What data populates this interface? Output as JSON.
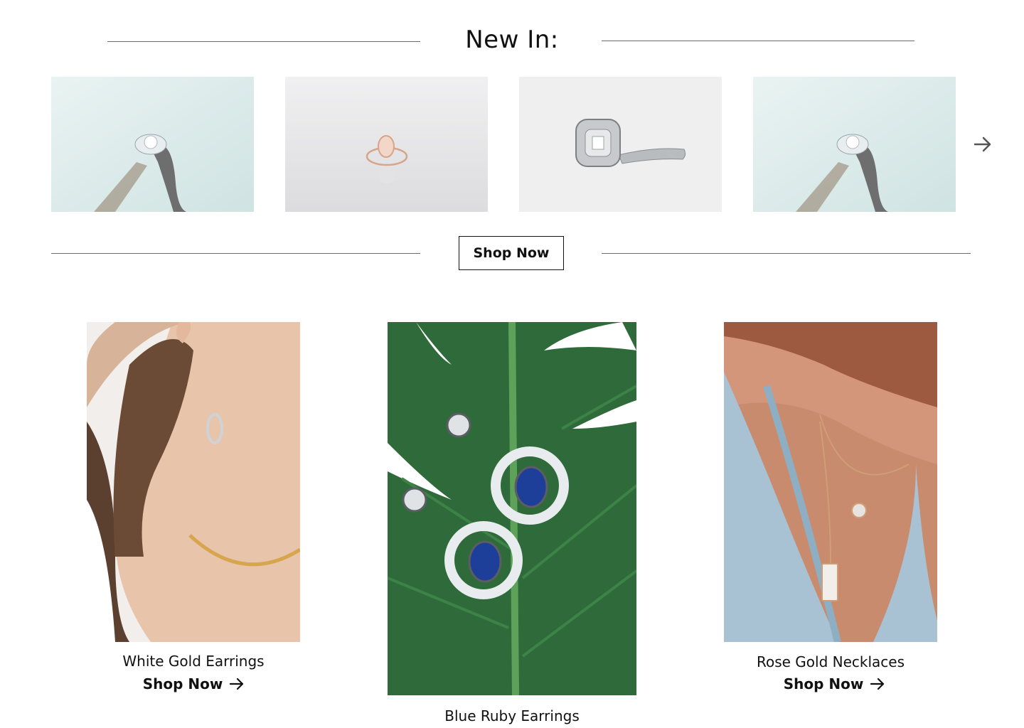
{
  "new_in": {
    "title": "New In:",
    "shop_now_label": "Shop Now",
    "next_icon": "arrow-right-icon",
    "products": [
      {
        "image": "solitaire-ring-photo"
      },
      {
        "image": "rose-gold-oval-ring-photo"
      },
      {
        "image": "cushion-halo-ring-photo"
      },
      {
        "image": "solitaire-ring-photo"
      }
    ]
  },
  "categories": [
    {
      "title": "White Gold Earrings",
      "link_label": "Shop Now",
      "image": "hoop-earring-model-photo",
      "link_icon": "arrow-right-icon"
    },
    {
      "title": "Blue Ruby Earrings",
      "image": "blue-drop-earrings-on-leaf-photo"
    },
    {
      "title": "Rose Gold Necklaces",
      "link_label": "Shop Now",
      "image": "layered-necklace-model-photo",
      "link_icon": "arrow-right-icon"
    }
  ],
  "colors": {
    "text": "#111111",
    "rule": "#6b6b6b",
    "leaf_green": "#2f6b3a",
    "gem_blue": "#1d3f9a"
  }
}
